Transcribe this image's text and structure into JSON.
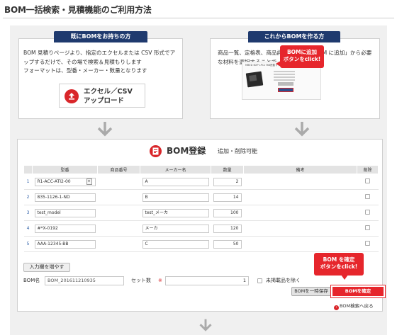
{
  "page": {
    "title": "BOM一括検索・見積機能のご利用方法"
  },
  "colors": {
    "accent_red": "#e6262c",
    "tab_navy": "#1f3a6e",
    "panel_bg": "#f0f0f0"
  },
  "left_card": {
    "tab": "既にBOMをお持ちの方",
    "text": "BOM 見積りページより、指定のエクセルまたは CSV 形式でアップするだけで、その場で検索＆見積もりします\nフォーマットは、型番・メーカー・数量となります",
    "upload_button": {
      "icon": "upload-icon",
      "line1": "エクセル／CSV",
      "line2": "アップロード"
    }
  },
  "right_card": {
    "tab": "これからBOMを作る方",
    "text": "商品一覧、定格表、商品詳細ページの「BOM に追加」から必要な材料を選択することで、BOM を作成",
    "preview_title": "MBED NXP LPC1768搭載マイコンモジュール [OM11043-598]",
    "callout": "BOMに追加\nボタンをclick!"
  },
  "bom_panel": {
    "title": "BOM登録",
    "subtitle": "追加・削除可能",
    "columns": [
      "",
      "型番",
      "商品番号",
      "メーカー名",
      "数量",
      "備考",
      "削除"
    ],
    "rows": [
      {
        "no": "1",
        "part": "R1-ACC-ATI2-00",
        "item": "",
        "maker": "A",
        "qty": "2",
        "note": ""
      },
      {
        "no": "2",
        "part": "835-1126-1-ND",
        "item": "",
        "maker": "B",
        "qty": "14",
        "note": ""
      },
      {
        "no": "3",
        "part": "test_model",
        "item": "",
        "maker": "test_メーカ",
        "qty": "100",
        "note": ""
      },
      {
        "no": "4",
        "part": "#*X-0192",
        "item": "",
        "maker": "メーカ",
        "qty": "120",
        "note": ""
      },
      {
        "no": "5",
        "part": "AAA-12345-BB",
        "item": "",
        "maker": "C",
        "qty": "50",
        "note": ""
      }
    ],
    "add_rows_button": "入力欄を増やす",
    "bom_name_label": "BOM名",
    "bom_name_value": "BOM_201611210935",
    "set_count_label": "セット数",
    "required_mark": "※",
    "set_count_value": "1",
    "exclude_label": "未掲載品を除く",
    "save_button": "BOMを一時保存",
    "confirm_button": "BOMを確定",
    "callout": "BOM を確定\nボタンをclick!",
    "back_link": "BOM検索へ戻る"
  }
}
